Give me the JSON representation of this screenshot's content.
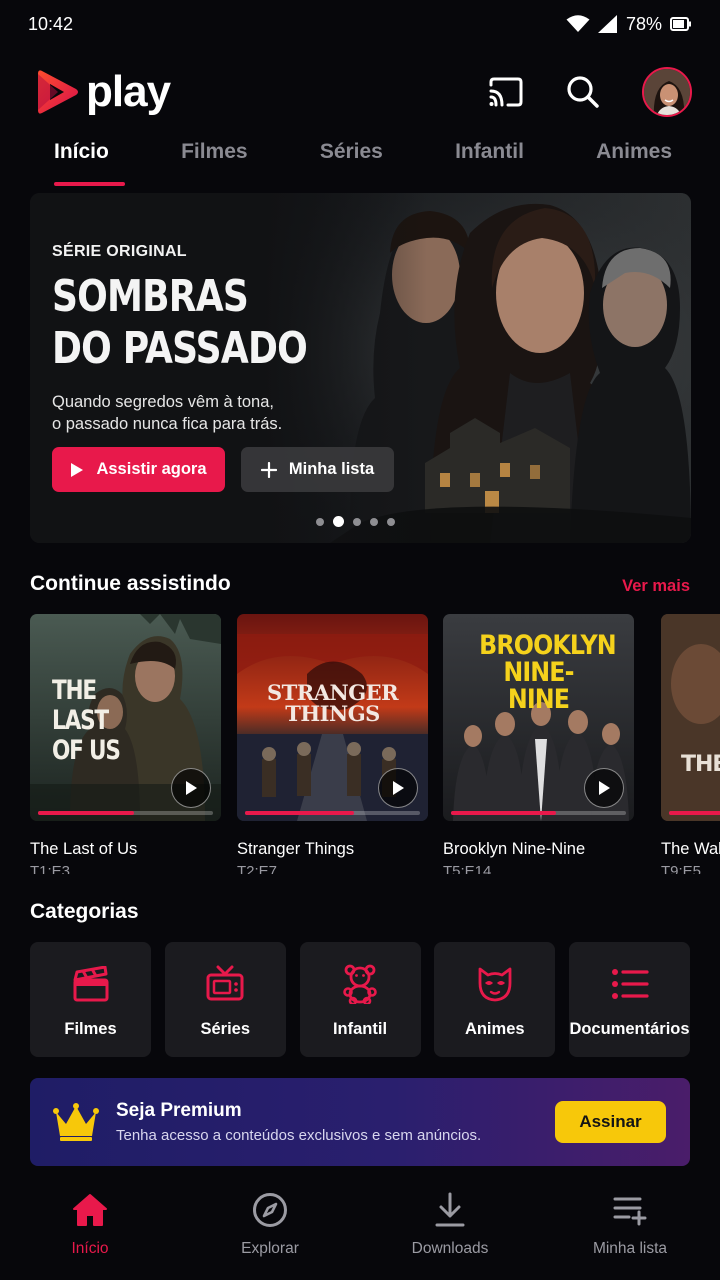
{
  "status_bar": {
    "time": "10:42",
    "battery": "78%"
  },
  "brand": {
    "name": "play",
    "accent": "#e8194b"
  },
  "header": {
    "icons": [
      "cast-icon",
      "search-icon"
    ],
    "avatar": "avatar"
  },
  "tabs": [
    {
      "label": "Início",
      "active": true
    },
    {
      "label": "Filmes",
      "active": false
    },
    {
      "label": "Séries",
      "active": false
    },
    {
      "label": "Infantil",
      "active": false
    },
    {
      "label": "Animes",
      "active": false
    }
  ],
  "hero": {
    "eyebrow": "SÉRIE ORIGINAL",
    "title_line1": "SOMBRAS",
    "title_line2": "DO PASSADO",
    "desc_line1": "Quando segredos vêm à tona,",
    "desc_line2": "o passado nunca fica para trás.",
    "primary_button": "Assistir agora",
    "secondary_button": "Minha lista",
    "carousel_active_index": 1,
    "carousel_count": 5
  },
  "continue_watching": {
    "title": "Continue assistindo",
    "see_more": "Ver mais",
    "items": [
      {
        "title": "The Last of Us",
        "episode": "T1:E3",
        "poster_text": "THE LAST OF US",
        "progress": 0.55
      },
      {
        "title": "Stranger Things",
        "episode": "T2:E7",
        "poster_text": "STRANGER THINGS",
        "progress": 0.62
      },
      {
        "title": "Brooklyn Nine-Nine",
        "episode": "T5:E14",
        "poster_text": "BROOKLYN NINE-NINE",
        "progress": 0.6
      },
      {
        "title": "The Walking Dead",
        "episode": "T9:E5",
        "poster_text": "THE WAL",
        "progress": 0.4
      }
    ]
  },
  "categories": {
    "title": "Categorias",
    "items": [
      {
        "label": "Filmes",
        "icon": "clapperboard-icon"
      },
      {
        "label": "Séries",
        "icon": "tv-icon"
      },
      {
        "label": "Infantil",
        "icon": "teddy-bear-icon"
      },
      {
        "label": "Animes",
        "icon": "anime-mask-icon"
      },
      {
        "label": "Documentários",
        "icon": "list-icon"
      }
    ]
  },
  "premium": {
    "title": "Seja Premium",
    "subtitle": "Tenha acesso a conteúdos exclusivos e sem anúncios.",
    "button": "Assinar",
    "button_color": "#f7c80a"
  },
  "bottom_nav": [
    {
      "label": "Início",
      "icon": "home-icon",
      "active": true
    },
    {
      "label": "Explorar",
      "icon": "compass-icon",
      "active": false
    },
    {
      "label": "Downloads",
      "icon": "download-icon",
      "active": false
    },
    {
      "label": "Minha lista",
      "icon": "playlist-add-icon",
      "active": false
    }
  ]
}
